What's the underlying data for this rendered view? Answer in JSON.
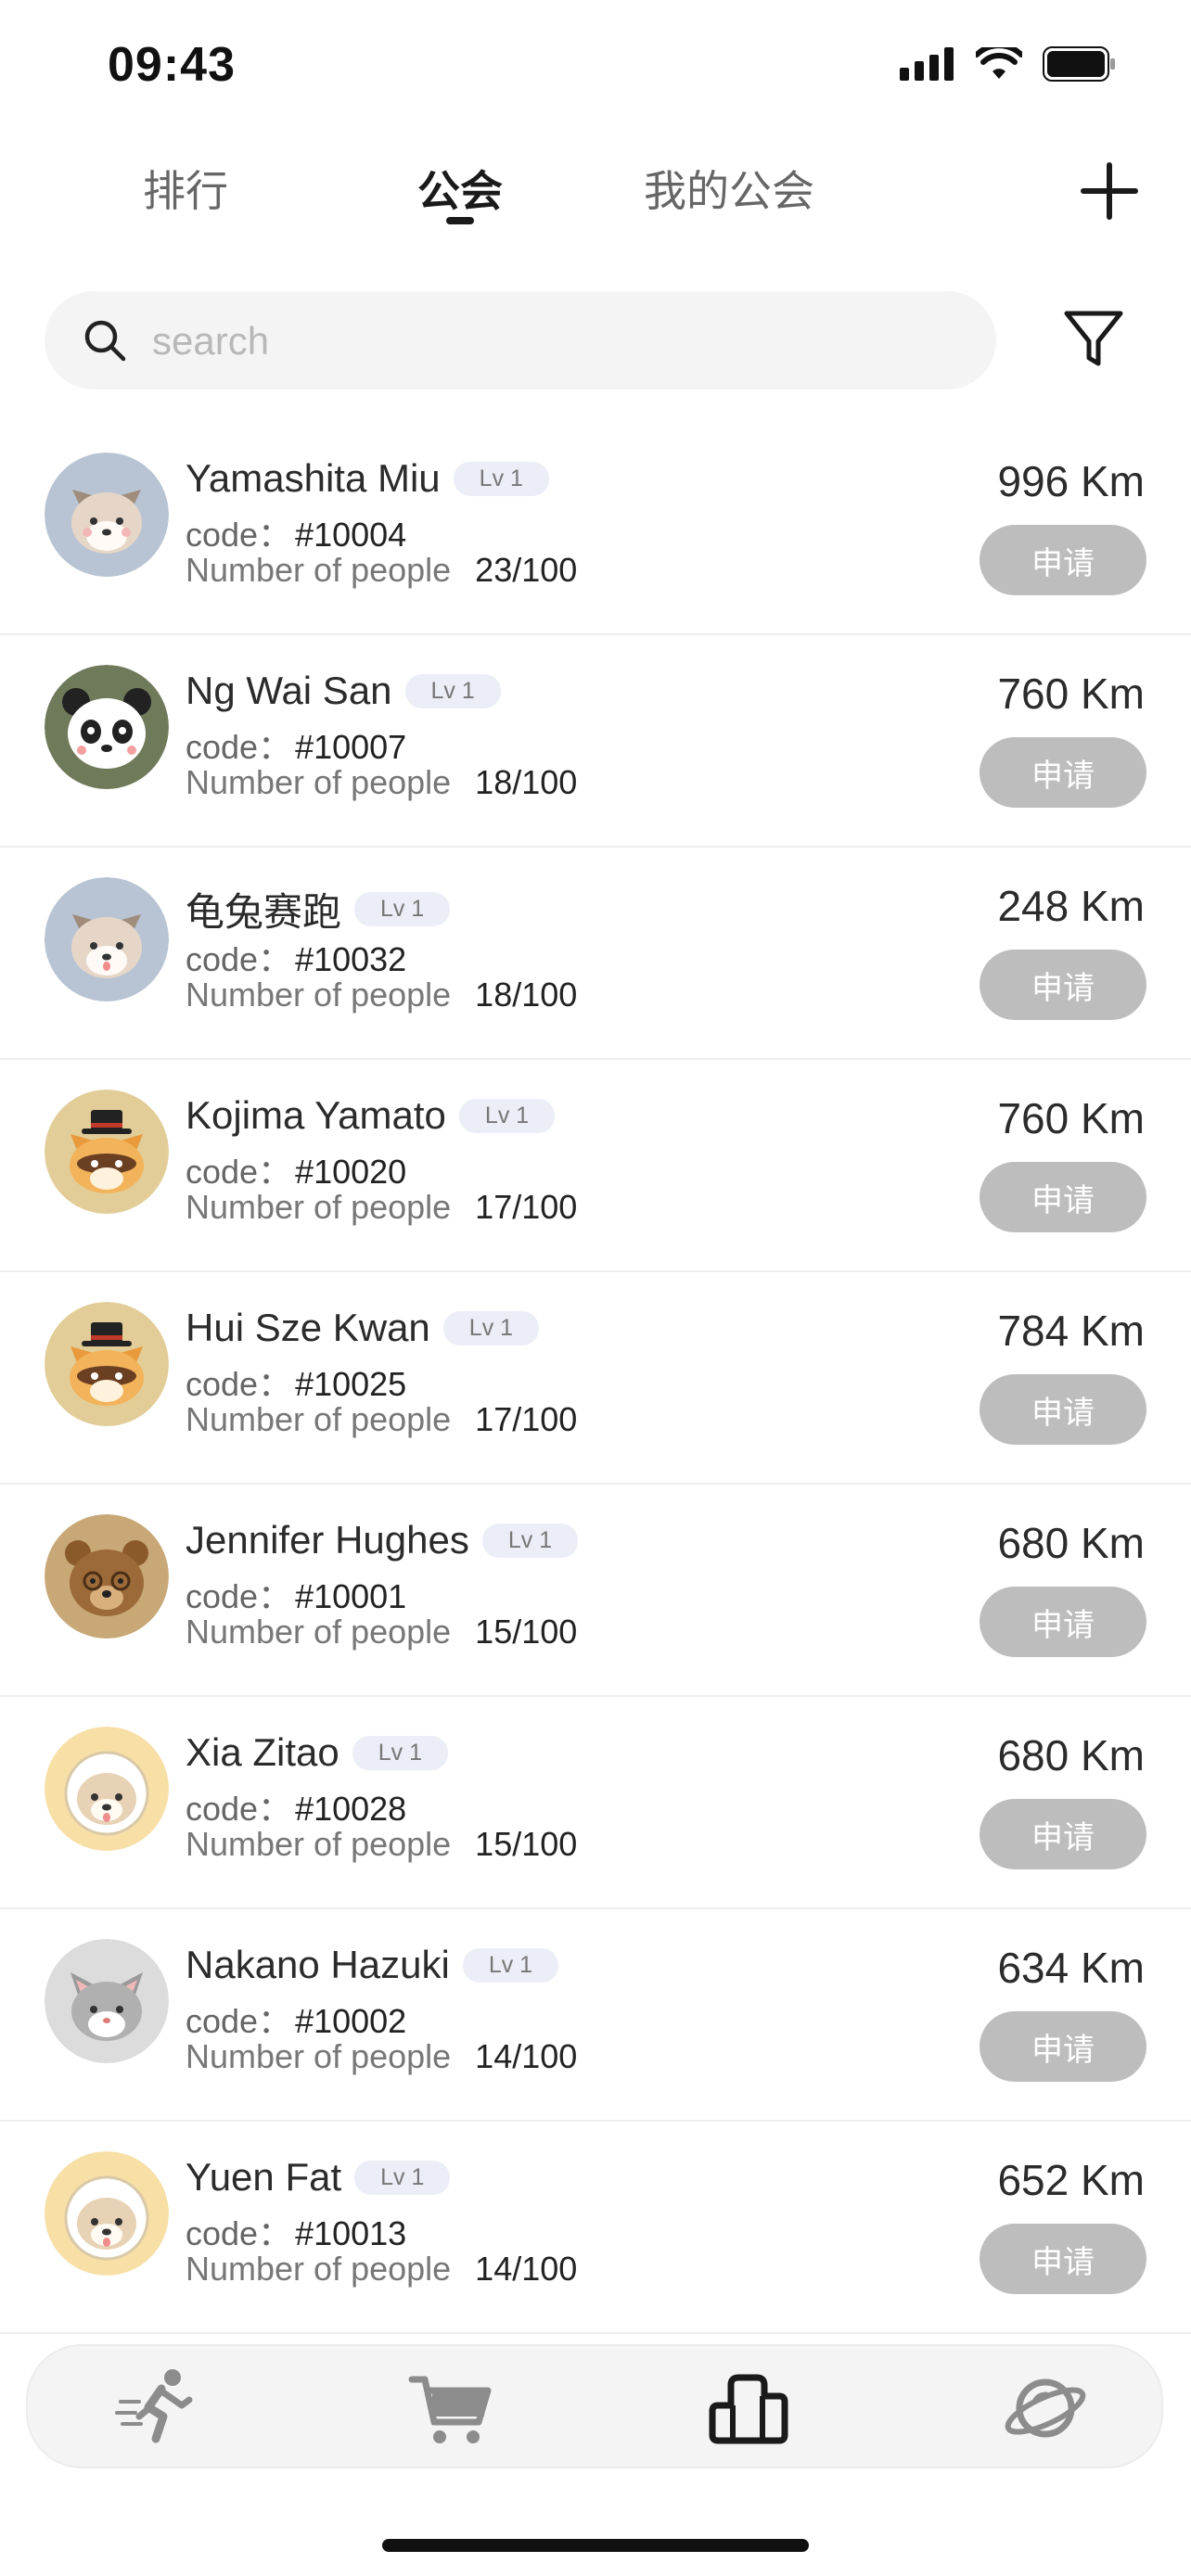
{
  "status_bar": {
    "time": "09:43"
  },
  "tabs": [
    {
      "label": "排行",
      "active": false
    },
    {
      "label": "公会",
      "active": true
    },
    {
      "label": "我的公会",
      "active": false
    }
  ],
  "search": {
    "placeholder": "search",
    "value": ""
  },
  "guilds": [
    {
      "name": "Yamashita Miu",
      "level": "Lv 1",
      "code_label": "code：",
      "code": "#10004",
      "people_label": "Number of people",
      "people": "23/100",
      "distance": "996 Km",
      "apply_label": "申请",
      "avatar": "shiba-dog-avatar",
      "avatar_bg": "#b8c3d3"
    },
    {
      "name": "Ng Wai San",
      "level": "Lv 1",
      "code_label": "code：",
      "code": "#10007",
      "people_label": "Number of people",
      "people": "18/100",
      "distance": "760 Km",
      "apply_label": "申请",
      "avatar": "panda-avatar",
      "avatar_bg": "#6f7a5a"
    },
    {
      "name": "龟兔赛跑",
      "level": "Lv 1",
      "code_label": "code：",
      "code": "#10032",
      "people_label": "Number of people",
      "people": "18/100",
      "distance": "248 Km",
      "apply_label": "申请",
      "avatar": "shiba-dog-avatar",
      "avatar_bg": "#b8c3d3"
    },
    {
      "name": "Kojima Yamato",
      "level": "Lv 1",
      "code_label": "code：",
      "code": "#10020",
      "people_label": "Number of people",
      "people": "17/100",
      "distance": "760 Km",
      "apply_label": "申请",
      "avatar": "raccoon-hat-avatar",
      "avatar_bg": "#e2cd98"
    },
    {
      "name": "Hui Sze Kwan",
      "level": "Lv 1",
      "code_label": "code：",
      "code": "#10025",
      "people_label": "Number of people",
      "people": "17/100",
      "distance": "784 Km",
      "apply_label": "申请",
      "avatar": "raccoon-hat-avatar",
      "avatar_bg": "#e2cd98"
    },
    {
      "name": "Jennifer Hughes",
      "level": "Lv 1",
      "code_label": "code：",
      "code": "#10001",
      "people_label": "Number of people",
      "people": "15/100",
      "distance": "680 Km",
      "apply_label": "申请",
      "avatar": "bear-avatar",
      "avatar_bg": "#c7a876"
    },
    {
      "name": "Xia Zitao",
      "level": "Lv 1",
      "code_label": "code：",
      "code": "#10028",
      "people_label": "Number of people",
      "people": "15/100",
      "distance": "680 Km",
      "apply_label": "申请",
      "avatar": "astronaut-dog-avatar",
      "avatar_bg": "#f7dfa6"
    },
    {
      "name": "Nakano Hazuki",
      "level": "Lv 1",
      "code_label": "code：",
      "code": "#10002",
      "people_label": "Number of people",
      "people": "14/100",
      "distance": "634 Km",
      "apply_label": "申请",
      "avatar": "grey-cat-avatar",
      "avatar_bg": "#dcdcdc"
    },
    {
      "name": "Yuen Fat",
      "level": "Lv 1",
      "code_label": "code：",
      "code": "#10013",
      "people_label": "Number of people",
      "people": "14/100",
      "distance": "652 Km",
      "apply_label": "申请",
      "avatar": "astronaut-dog-avatar",
      "avatar_bg": "#f7dfa6"
    }
  ],
  "bottom_nav": [
    {
      "icon": "running-person-icon",
      "active": false
    },
    {
      "icon": "shopping-cart-icon",
      "active": false
    },
    {
      "icon": "guild-podium-icon",
      "active": true
    },
    {
      "icon": "planet-icon",
      "active": false
    }
  ],
  "colors": {
    "apply_button": "#bdbdbd",
    "level_badge_bg": "#eceef7",
    "nav_bg": "#f4f4f4",
    "active_icon": "#1a1a1a",
    "inactive_icon": "#8c8c8c"
  }
}
